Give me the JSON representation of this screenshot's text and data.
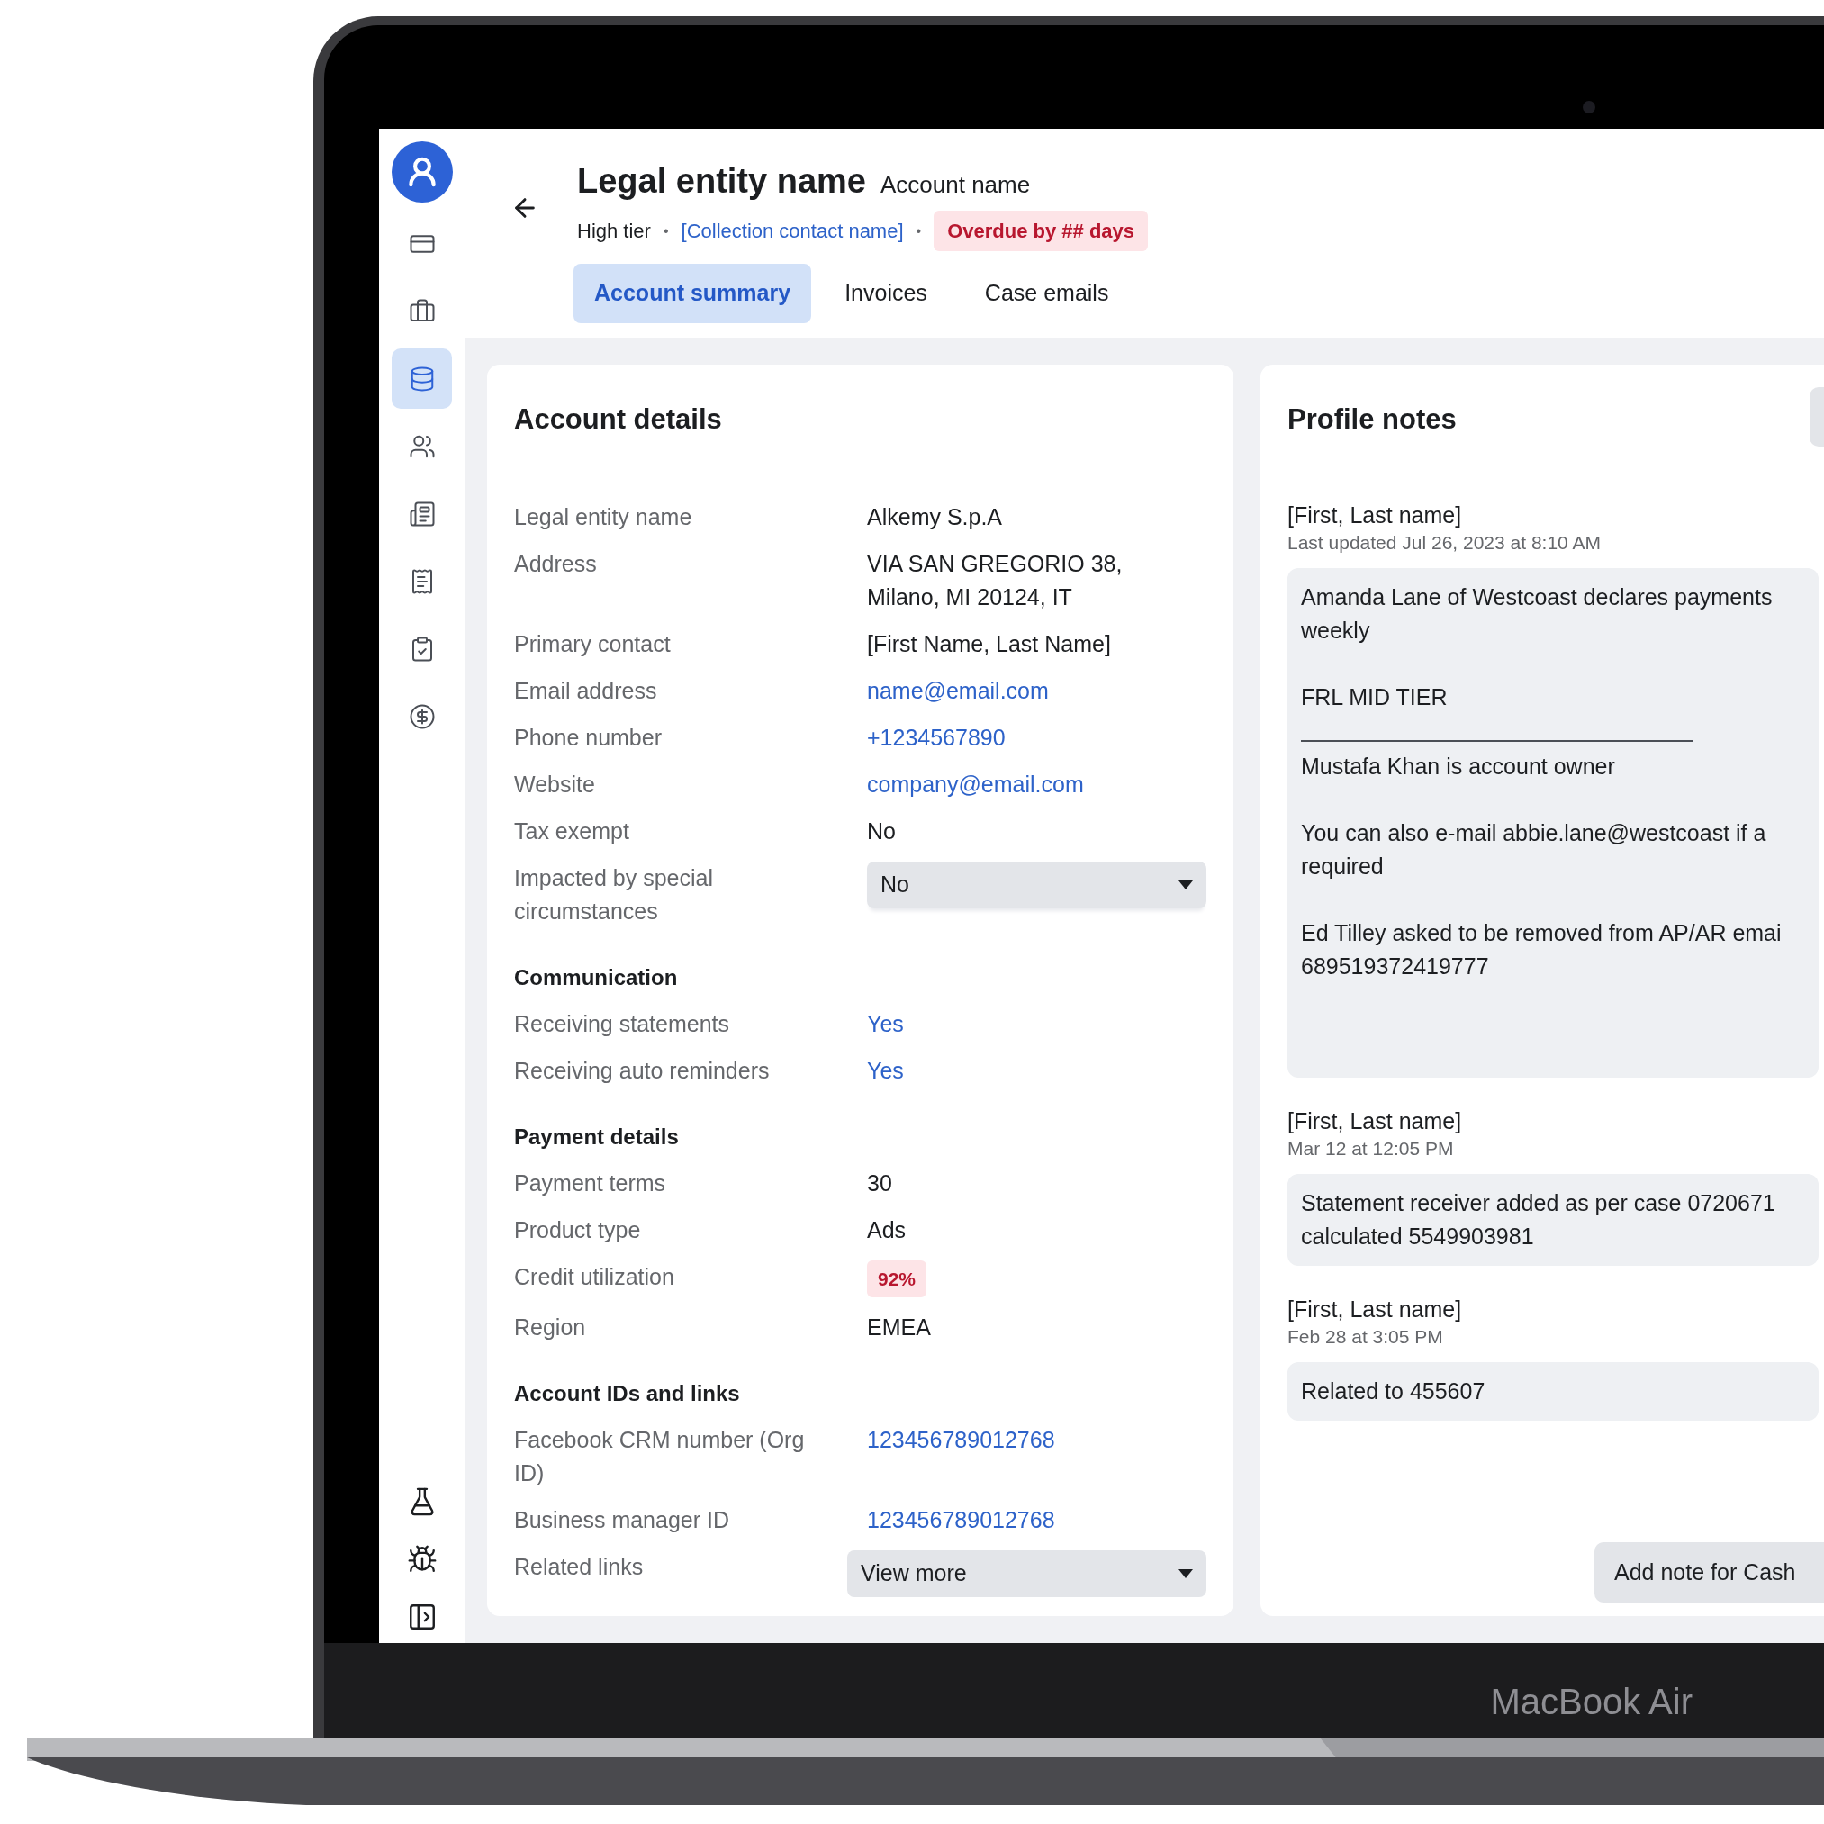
{
  "device": {
    "label": "MacBook Air"
  },
  "sidebar": {
    "items": [
      {
        "selected": false
      },
      {
        "selected": false
      },
      {
        "selected": true
      },
      {
        "selected": false
      },
      {
        "selected": false
      },
      {
        "selected": false
      },
      {
        "selected": false
      },
      {
        "selected": false
      }
    ]
  },
  "header": {
    "title": "Legal entity name",
    "subtitle": "Account name",
    "tier": "High tier",
    "separator": "•",
    "contact": "[Collection contact name]",
    "overdue": "Overdue by ## days"
  },
  "tabs": [
    {
      "label": "Account summary",
      "selected": true
    },
    {
      "label": "Invoices",
      "selected": false
    },
    {
      "label": "Case emails",
      "selected": false
    }
  ],
  "account_details": {
    "title": "Account details",
    "sections": [
      {
        "rows": [
          {
            "label": "Legal entity name",
            "kind": "text",
            "value": "Alkemy S.p.A"
          },
          {
            "label": "Address",
            "kind": "text",
            "value": "VIA SAN GREGORIO 38,\nMilano, MI 20124, IT"
          },
          {
            "label": "Primary contact",
            "kind": "text",
            "value": "[First Name, Last Name]"
          },
          {
            "label": "Email address",
            "kind": "link",
            "value": "name@email.com"
          },
          {
            "label": "Phone number",
            "kind": "link",
            "value": "+1234567890"
          },
          {
            "label": "Website",
            "kind": "link",
            "value": "company@email.com"
          },
          {
            "label": "Tax exempt",
            "kind": "text",
            "value": "No"
          },
          {
            "label": "Impacted by special circumstances",
            "kind": "select",
            "value": "No"
          }
        ]
      },
      {
        "heading": "Communication",
        "rows": [
          {
            "label": "Receiving statements",
            "kind": "link",
            "value": "Yes"
          },
          {
            "label": "Receiving auto reminders",
            "kind": "link",
            "value": "Yes"
          }
        ]
      },
      {
        "heading": "Payment details",
        "rows": [
          {
            "label": "Payment terms",
            "kind": "text",
            "value": "30"
          },
          {
            "label": "Product type",
            "kind": "text",
            "value": "Ads"
          },
          {
            "label": "Credit utilization",
            "kind": "badge",
            "value": "92%"
          },
          {
            "label": "Region",
            "kind": "text",
            "value": "EMEA"
          }
        ]
      },
      {
        "heading": "Account IDs and links",
        "rows": [
          {
            "label": "Facebook CRM number (Org ID)",
            "kind": "link",
            "value": "123456789012768"
          },
          {
            "label": "Business manager ID",
            "kind": "link",
            "value": "123456789012768"
          },
          {
            "label": "Related links",
            "kind": "wideselect",
            "value": "View more"
          }
        ]
      }
    ]
  },
  "profile_notes": {
    "title": "Profile notes",
    "notes": [
      {
        "author": "[First, Last name]",
        "time": "Last updated Jul 26, 2023 at 8:10 AM",
        "tall": true,
        "blocks": [
          {
            "kind": "text",
            "lines": [
              "Amanda Lane of Westcoast declares payments",
              "weekly"
            ]
          },
          {
            "kind": "text",
            "lines": [
              "FRL MID TIER"
            ]
          },
          {
            "kind": "rule"
          },
          {
            "kind": "text",
            "lines": [
              "Mustafa Khan is account owner"
            ]
          },
          {
            "kind": "text",
            "lines": [
              "You can also e-mail abbie.lane@westcoast if a",
              "required"
            ]
          },
          {
            "kind": "text",
            "lines": [
              "Ed Tilley asked to be removed from AP/AR emai",
              "689519372419777"
            ]
          }
        ]
      },
      {
        "author": "[First, Last name]",
        "time": "Mar 12 at 12:05 PM",
        "tall": false,
        "blocks": [
          {
            "kind": "text",
            "lines": [
              "Statement receiver added as per case 0720671",
              "calculated 5549903981"
            ]
          }
        ]
      },
      {
        "author": "[First, Last name]",
        "time": "Feb 28 at 3:05 PM",
        "tall": false,
        "blocks": [
          {
            "kind": "text",
            "lines": [
              "Related to 455607"
            ]
          }
        ]
      }
    ],
    "button": "Add note for Cash"
  }
}
